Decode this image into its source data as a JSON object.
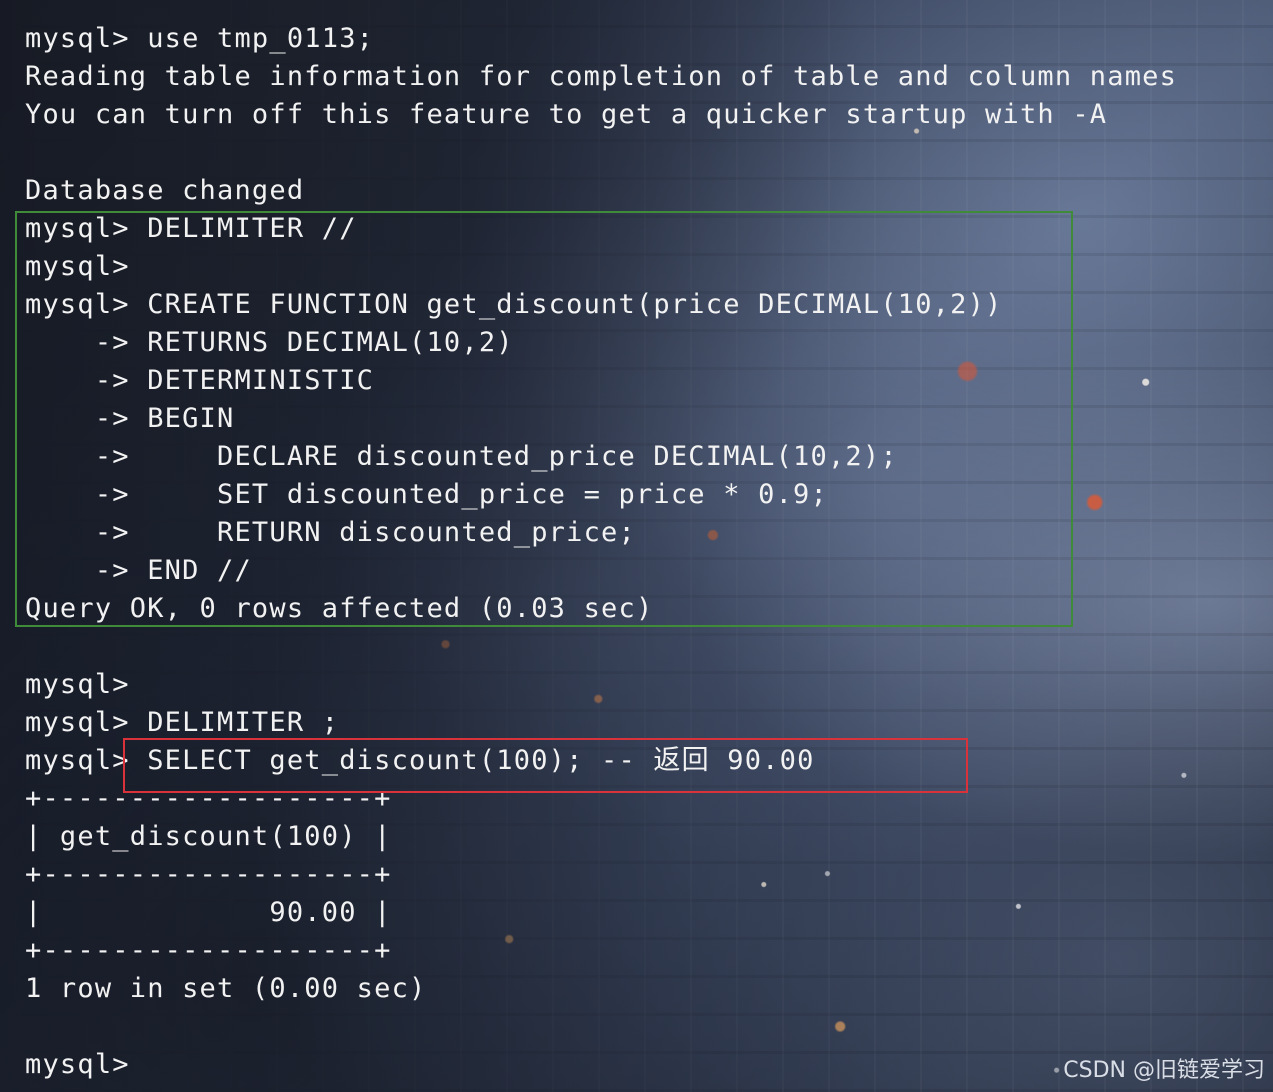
{
  "terminal": {
    "lines": [
      "mysql> use tmp_0113;",
      "Reading table information for completion of table and column names",
      "You can turn off this feature to get a quicker startup with -A",
      "",
      "Database changed",
      "mysql> DELIMITER //",
      "mysql>",
      "mysql> CREATE FUNCTION get_discount(price DECIMAL(10,2))",
      "    -> RETURNS DECIMAL(10,2)",
      "    -> DETERMINISTIC",
      "    -> BEGIN",
      "    ->     DECLARE discounted_price DECIMAL(10,2);",
      "    ->     SET discounted_price = price * 0.9;",
      "    ->     RETURN discounted_price;",
      "    -> END //",
      "Query OK, 0 rows affected (0.03 sec)",
      "",
      "mysql>",
      "mysql> DELIMITER ;",
      "mysql> SELECT get_discount(100); -- 返回 90.00",
      "+-------------------+",
      "| get_discount(100) |",
      "+-------------------+",
      "|             90.00 |",
      "+-------------------+",
      "1 row in set (0.00 sec)",
      "",
      "mysql>"
    ]
  },
  "highlights": {
    "green_box_color": "#3f8b3a",
    "red_box_color": "#d9323a"
  },
  "watermark": "CSDN @旧链爱学习"
}
